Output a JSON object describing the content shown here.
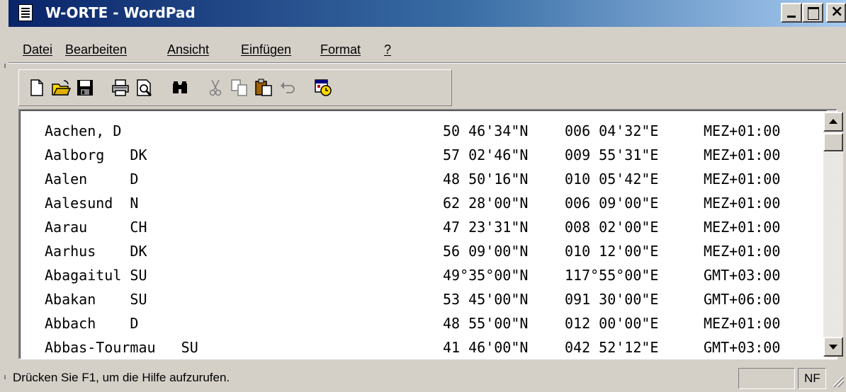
{
  "window": {
    "title": "W-ORTE - WordPad",
    "controls": {
      "minimize": "_",
      "maximize": "□",
      "close": "×"
    }
  },
  "menu": [
    {
      "label": "Datei",
      "underline": "D"
    },
    {
      "label": "Bearbeiten",
      "underline": "B"
    },
    {
      "label": "Ansicht",
      "underline": "A"
    },
    {
      "label": "Einfügen",
      "underline": "E"
    },
    {
      "label": "Format",
      "underline": "t"
    },
    {
      "label": "?",
      "underline": "?"
    }
  ],
  "toolbar": [
    {
      "icon": "new-document-icon"
    },
    {
      "icon": "open-folder-icon"
    },
    {
      "icon": "save-disk-icon"
    },
    {
      "icon": "print-icon"
    },
    {
      "icon": "print-preview-icon"
    },
    {
      "icon": "find-binoculars-icon"
    },
    {
      "icon": "cut-scissors-icon",
      "disabled": true
    },
    {
      "icon": "copy-icon",
      "disabled": true
    },
    {
      "icon": "paste-icon"
    },
    {
      "icon": "undo-icon",
      "disabled": true
    },
    {
      "icon": "date-time-icon"
    }
  ],
  "document": {
    "rows": [
      {
        "name": "Aachen, D",
        "lat": "50 46'34\"N",
        "lon": "006 04'32\"E",
        "tz": "MEZ+01:00"
      },
      {
        "name": "Aalborg   DK",
        "lat": "57 02'46\"N",
        "lon": "009 55'31\"E",
        "tz": "MEZ+01:00"
      },
      {
        "name": "Aalen     D",
        "lat": "48 50'16\"N",
        "lon": "010 05'42\"E",
        "tz": "MEZ+01:00"
      },
      {
        "name": "Aalesund  N",
        "lat": "62 28'00\"N",
        "lon": "006 09'00\"E",
        "tz": "MEZ+01:00"
      },
      {
        "name": "Aarau     CH",
        "lat": "47 23'31\"N",
        "lon": "008 02'00\"E",
        "tz": "MEZ+01:00"
      },
      {
        "name": "Aarhus    DK",
        "lat": "56 09'00\"N",
        "lon": "010 12'00\"E",
        "tz": "MEZ+01:00"
      },
      {
        "name": "Abagaitul SU",
        "lat": "49°35°00\"N",
        "lon": "117°55°00\"E",
        "tz": "GMT+03:00"
      },
      {
        "name": "Abakan    SU",
        "lat": "53 45'00\"N",
        "lon": "091 30'00\"E",
        "tz": "GMT+06:00"
      },
      {
        "name": "Abbach    D",
        "lat": "48 55'00\"N",
        "lon": "012 00'00\"E",
        "tz": "MEZ+01:00"
      },
      {
        "name": "Abbas-Tourmau   SU",
        "lat": "41 46'00\"N",
        "lon": "042 52'12\"E",
        "tz": "GMT+03:00"
      }
    ]
  },
  "status": {
    "help_text": "Drücken Sie F1, um die Hilfe aufzurufen.",
    "pane_empty": "",
    "pane_nf": "NF"
  },
  "colors": {
    "title_start": "#0a246a",
    "title_end": "#a6caf0",
    "face": "#d4d0c8"
  }
}
